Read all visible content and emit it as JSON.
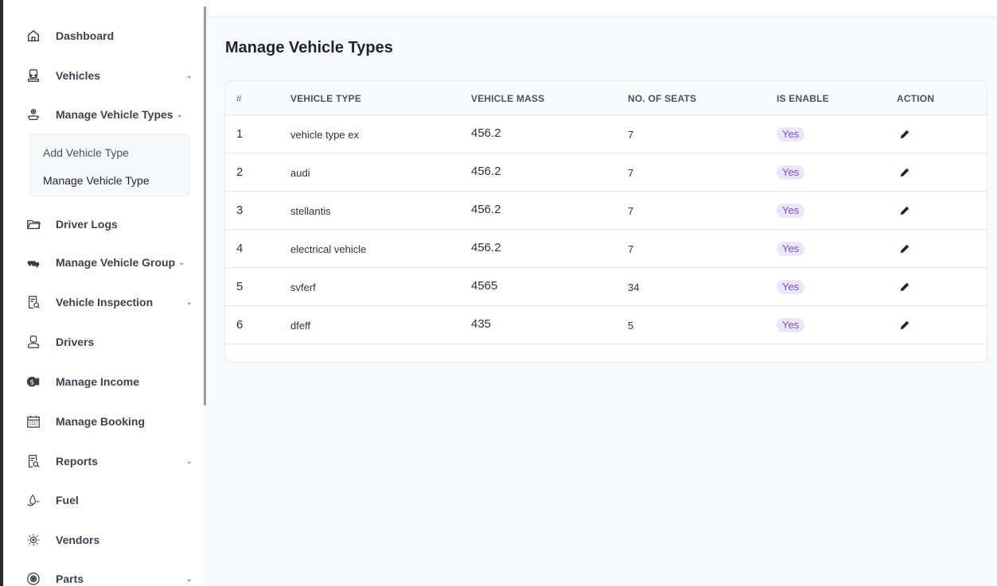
{
  "sidebar": {
    "items": [
      {
        "label": "Dashboard",
        "icon": "home-icon",
        "chevron": false
      },
      {
        "label": "Vehicles",
        "icon": "vehicle-icon",
        "chevron": true
      },
      {
        "label": "Manage Vehicle Types",
        "icon": "vehicle-types-icon",
        "chevron": true
      },
      {
        "label": "Driver Logs",
        "icon": "folder-icon",
        "chevron": false
      },
      {
        "label": "Manage Vehicle Group",
        "icon": "vehicle-group-icon",
        "chevron": true
      },
      {
        "label": "Vehicle Inspection",
        "icon": "inspection-icon",
        "chevron": true
      },
      {
        "label": "Drivers",
        "icon": "driver-icon",
        "chevron": false
      },
      {
        "label": "Manage Income",
        "icon": "income-icon",
        "chevron": false
      },
      {
        "label": "Manage Booking",
        "icon": "calendar-icon",
        "chevron": false
      },
      {
        "label": "Reports",
        "icon": "reports-icon",
        "chevron": true
      },
      {
        "label": "Fuel",
        "icon": "fuel-icon",
        "chevron": false
      },
      {
        "label": "Vendors",
        "icon": "vendors-icon",
        "chevron": false
      },
      {
        "label": "Parts",
        "icon": "parts-icon",
        "chevron": true
      }
    ],
    "submenu": {
      "add": "Add Vehicle Type",
      "manage": "Manage Vehicle Type"
    },
    "chevron_glyph": "⌄"
  },
  "main": {
    "title": "Manage Vehicle Types",
    "table": {
      "headers": [
        "#",
        "VEHICLE TYPE",
        "VEHICLE MASS",
        "NO. OF SEATS",
        "IS ENABLE",
        "ACTION"
      ],
      "rows": [
        {
          "num": "1",
          "type": "vehicle type ex",
          "mass": "456.2",
          "seats": "7",
          "enabled": "Yes"
        },
        {
          "num": "2",
          "type": "audi",
          "mass": "456.2",
          "seats": "7",
          "enabled": "Yes"
        },
        {
          "num": "3",
          "type": "stellantis",
          "mass": "456.2",
          "seats": "7",
          "enabled": "Yes"
        },
        {
          "num": "4",
          "type": "electrical vehicle",
          "mass": "456.2",
          "seats": "7",
          "enabled": "Yes"
        },
        {
          "num": "5",
          "type": "svferf",
          "mass": "4565",
          "seats": "34",
          "enabled": "Yes"
        },
        {
          "num": "6",
          "type": "dfeff",
          "mass": "435",
          "seats": "5",
          "enabled": "Yes"
        }
      ]
    }
  },
  "colors": {
    "badge_bg": "#ece6fb",
    "badge_text": "#7c4ddb",
    "sidebar_bg": "#ffffff",
    "page_bg": "#f8f9fb"
  }
}
